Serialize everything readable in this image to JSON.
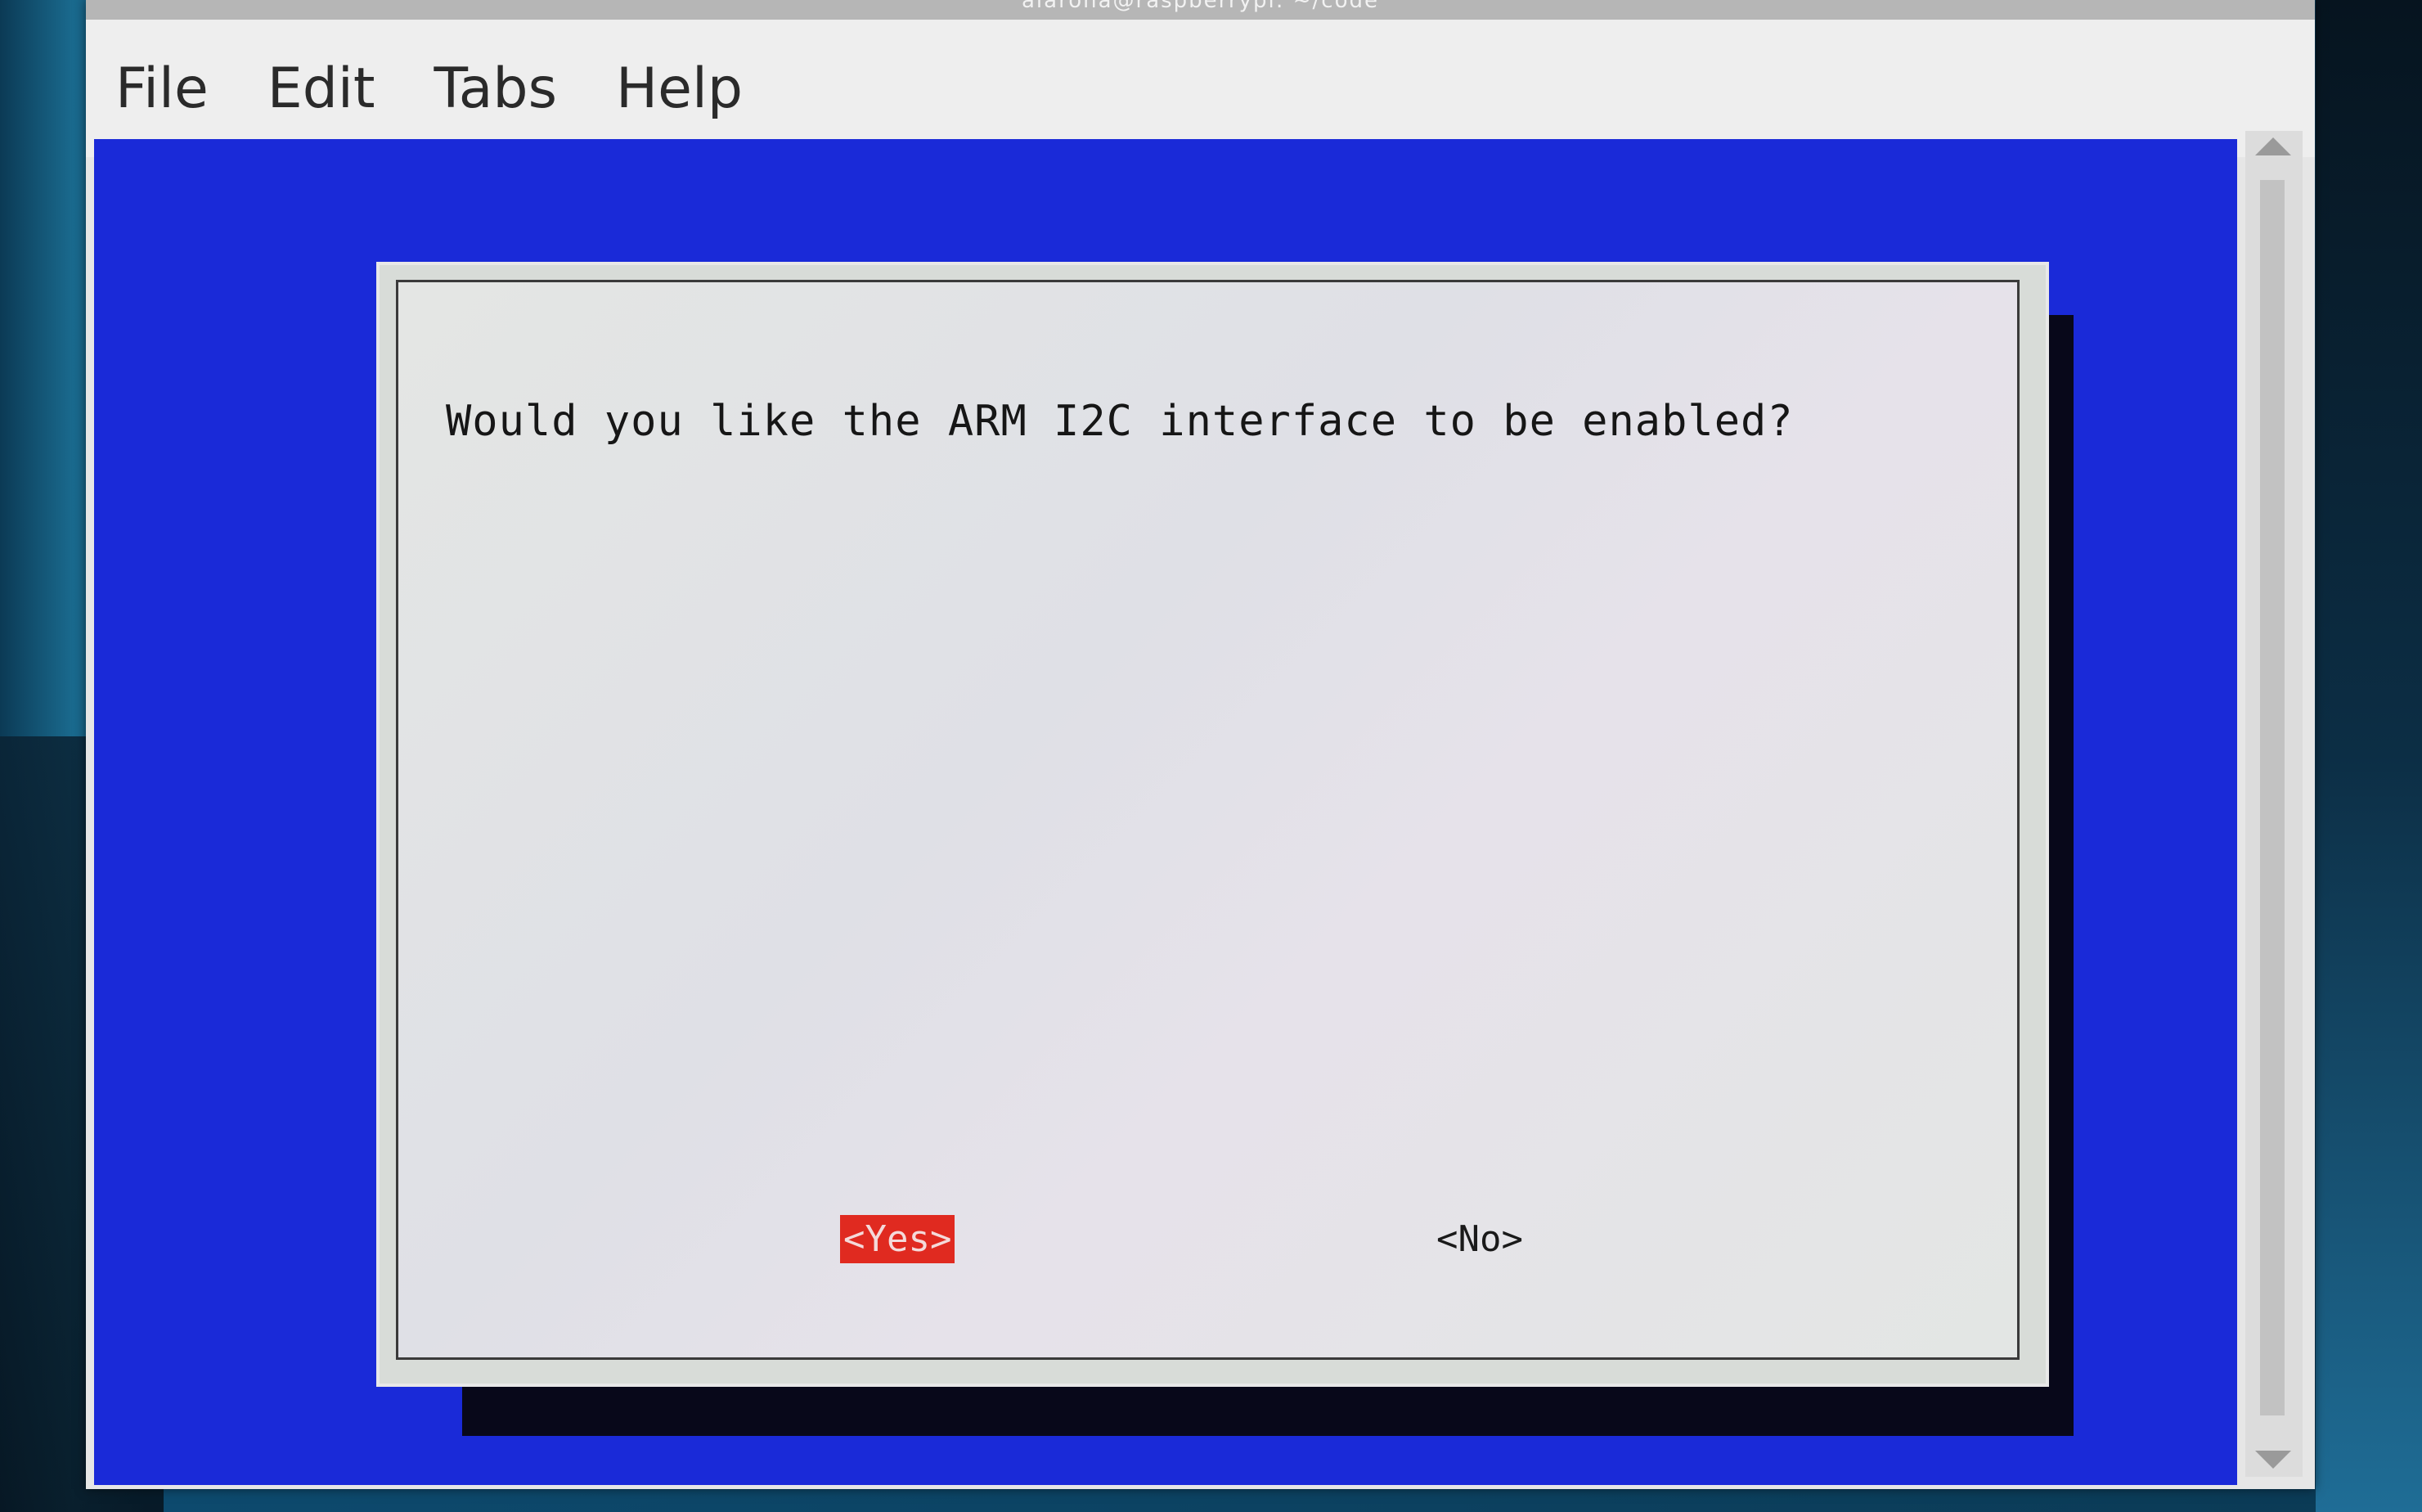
{
  "window": {
    "title": "alarona@raspberrypi: ~/code"
  },
  "menubar": {
    "items": [
      "File",
      "Edit",
      "Tabs",
      "Help"
    ]
  },
  "dialog": {
    "prompt": "Would you like the ARM I2C interface to be enabled?",
    "yes_label": "<Yes>",
    "no_label": "<No>",
    "selected": "<Yes>"
  },
  "colors": {
    "terminal_background": "#1a2ad8",
    "dialog_background": "#d8dcd8",
    "selected_button": "#e02a20"
  }
}
